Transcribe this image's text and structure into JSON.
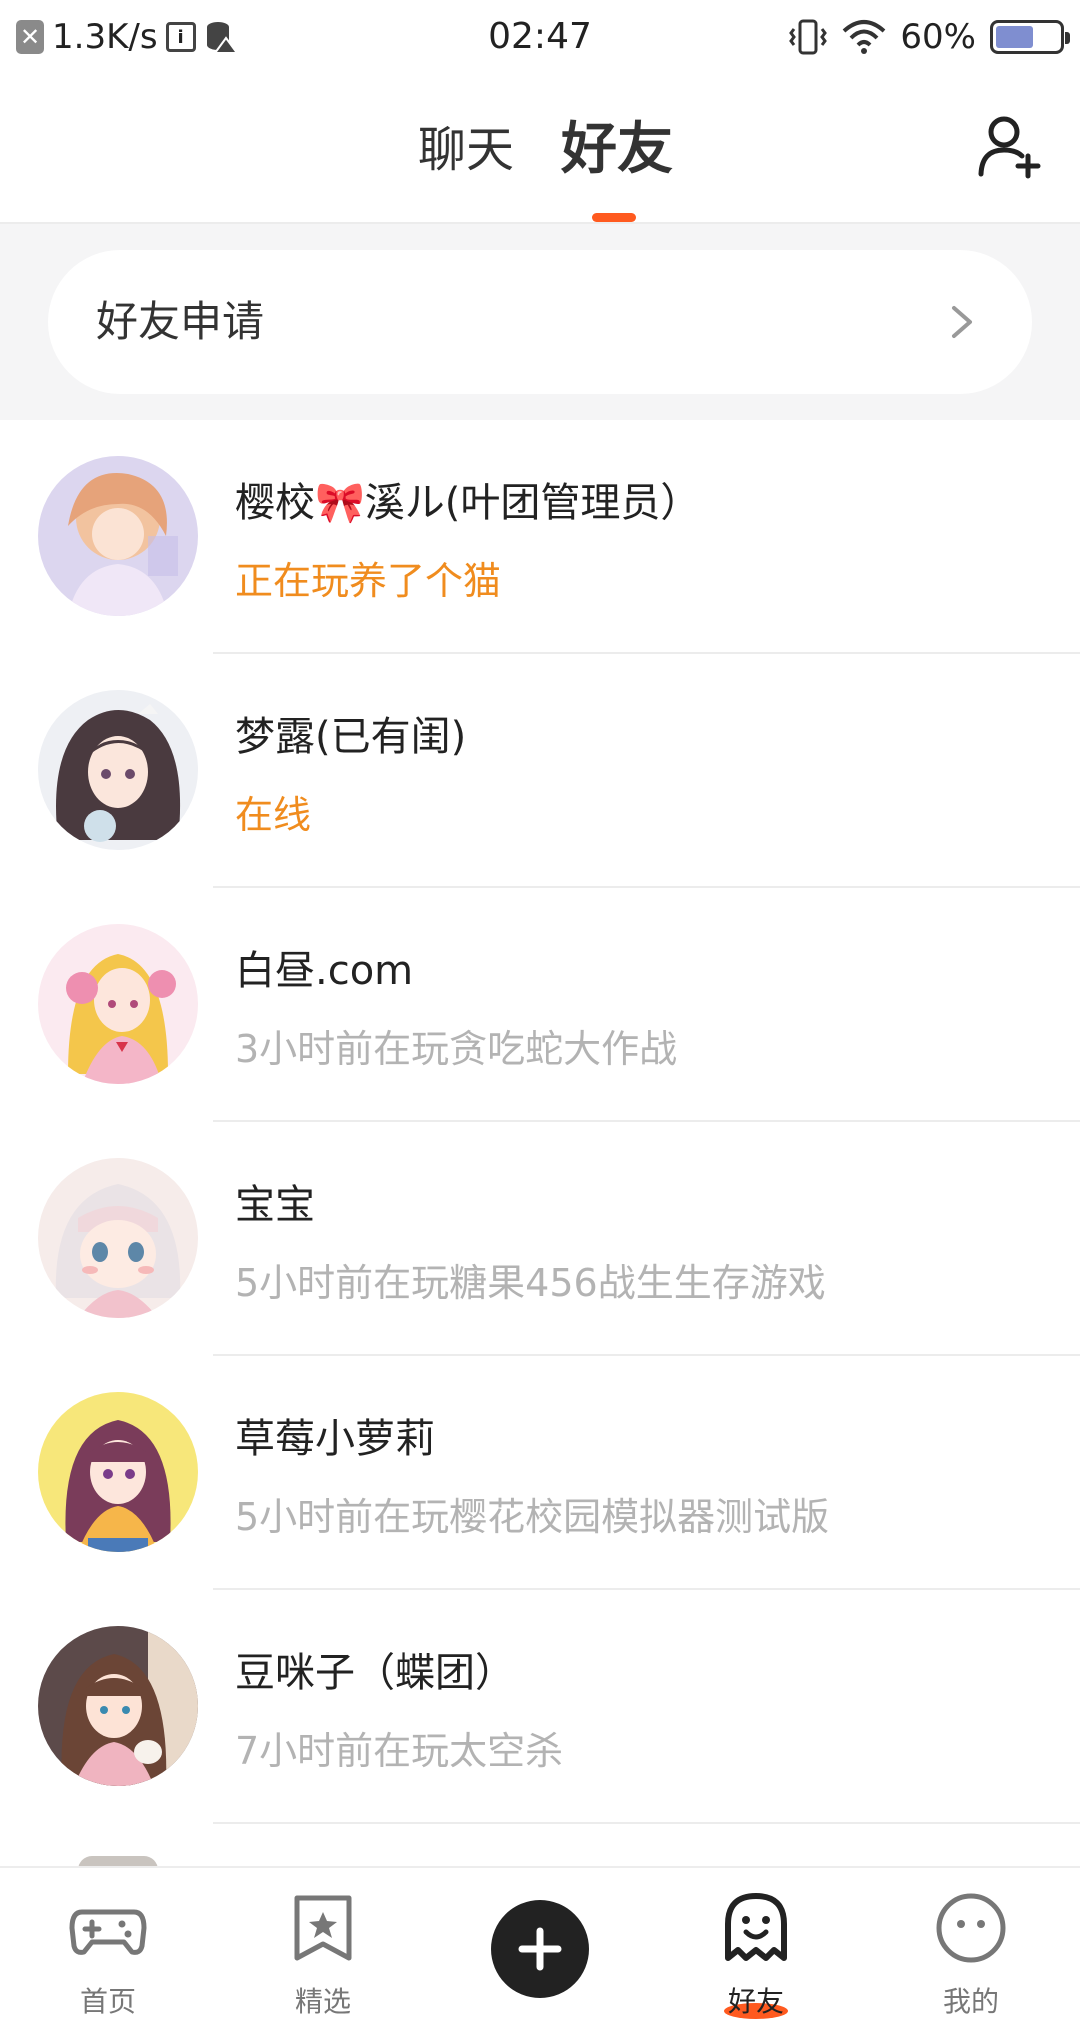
{
  "status_bar": {
    "speed": "1.3K/s",
    "time": "02:47",
    "battery": "60%",
    "battery_level": 0.6
  },
  "header": {
    "tab_chat": "聊天",
    "tab_friends": "好友"
  },
  "friend_request": {
    "label": "好友申请"
  },
  "friends": [
    {
      "name": "樱校🎀溪ル(叶团管理员）",
      "status": "正在玩养了个猫",
      "state": "online"
    },
    {
      "name": "梦露(已有闺)",
      "status": "在线",
      "state": "online"
    },
    {
      "name": "白昼.com",
      "status": "3小时前在玩贪吃蛇大作战",
      "state": "offline"
    },
    {
      "name": "宝宝",
      "status": "5小时前在玩糖果456战生生存游戏",
      "state": "offline"
    },
    {
      "name": "草莓小萝莉",
      "status": "5小时前在玩樱花校园模拟器测试版",
      "state": "offline"
    },
    {
      "name": "豆咪子（蝶团）",
      "status": "7小时前在玩太空杀",
      "state": "offline"
    }
  ],
  "bottom_nav": {
    "home": "首页",
    "featured": "精选",
    "friends": "好友",
    "mine": "我的"
  },
  "colors": {
    "accent": "#ff5a1f",
    "online": "#f08c1e",
    "offline": "#b3b3b3"
  },
  "icons": [
    "add-friend-icon",
    "chevron-right-icon",
    "gamepad-icon",
    "star-bookmark-icon",
    "plus-icon",
    "ghost-icon",
    "smiley-icon"
  ]
}
